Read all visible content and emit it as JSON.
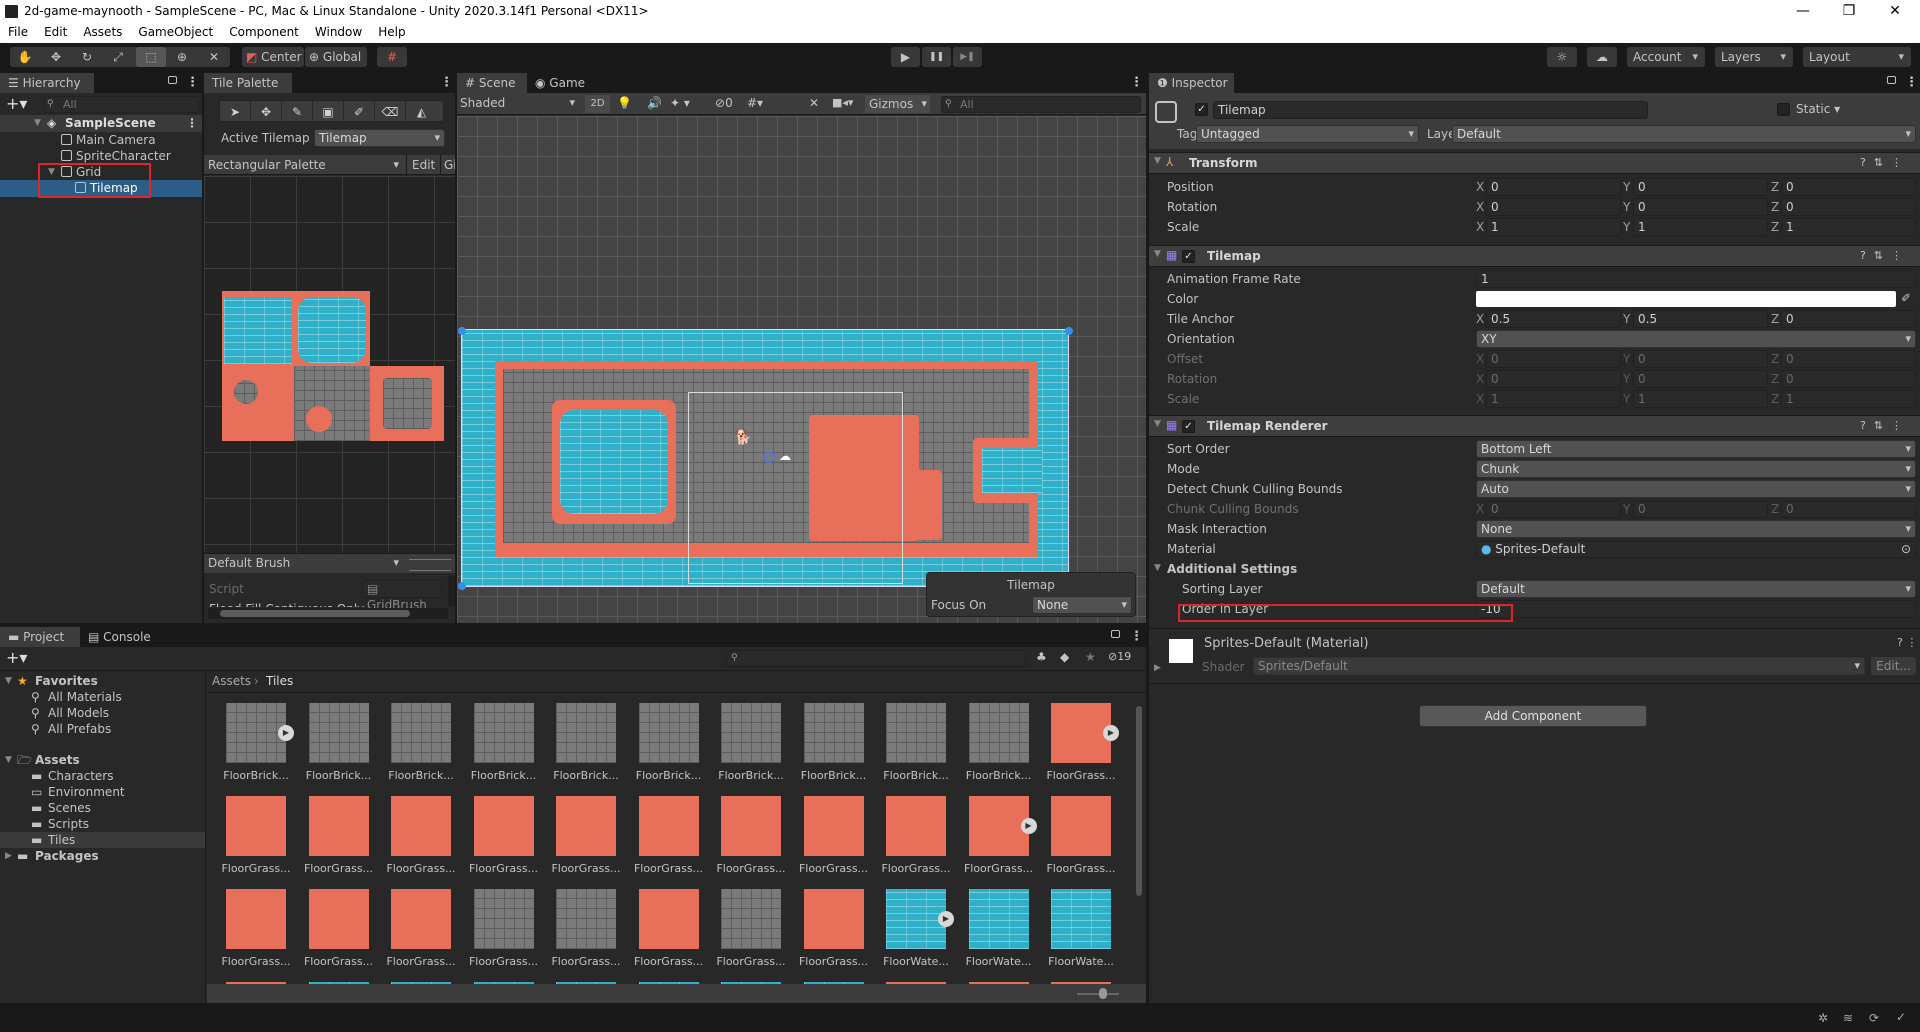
{
  "window": {
    "title": "2d-game-maynooth - SampleScene - PC, Mac & Linux Standalone - Unity 2020.3.14f1 Personal <DX11>",
    "controls": {
      "minimize": "—",
      "maximize": "❐",
      "close": "✕"
    }
  },
  "menu": [
    "File",
    "Edit",
    "Assets",
    "GameObject",
    "Component",
    "Window",
    "Help"
  ],
  "toolbar": {
    "tools": [
      "hand-tool",
      "move-tool",
      "rotate-tool",
      "scale-tool",
      "rect-tool",
      "transform-tool",
      "custom-tool"
    ],
    "active_tool": "rect-tool",
    "pivot_mode": "Center",
    "pivot_rotation": "Global",
    "play": "▶",
    "pause": "❚❚",
    "step": "▶❚",
    "account": "Account",
    "layers": "Layers",
    "layout": "Layout"
  },
  "hierarchy": {
    "tab": "Hierarchy",
    "search_placeholder": "All",
    "items": [
      {
        "label": "SampleScene",
        "depth": 0,
        "type": "scene",
        "expanded": true
      },
      {
        "label": "Main Camera",
        "depth": 1,
        "type": "gameobject"
      },
      {
        "label": "SpriteCharacter",
        "depth": 1,
        "type": "gameobject"
      },
      {
        "label": "Grid",
        "depth": 1,
        "type": "gameobject",
        "expanded": true,
        "highlighted": true
      },
      {
        "label": "Tilemap",
        "depth": 2,
        "type": "gameobject",
        "selected": true,
        "highlighted": true
      }
    ]
  },
  "tile_palette": {
    "tab": "Tile Palette",
    "tools": [
      "select",
      "move",
      "paint",
      "box-fill",
      "picker",
      "erase",
      "flood-fill"
    ],
    "active_tilemap_label": "Active Tilemap",
    "active_tilemap_value": "Tilemap",
    "palette": "Rectangular Palette",
    "edit": "Edit",
    "gizmos": "Gi",
    "brush": "Default Brush",
    "script_label": "Script",
    "script_value": "GridBrush",
    "flood_fill_label": "Flood Fill Contiguous Only"
  },
  "scene": {
    "tabs": [
      "Scene",
      "Game"
    ],
    "active_tab": "Scene",
    "shading": "Shaded",
    "mode_2d": "2D",
    "hidden_count": "0",
    "gizmos": "Gizmos",
    "search_placeholder": "All",
    "overlay_title": "Tilemap",
    "focus_label": "Focus On",
    "focus_value": "None"
  },
  "inspector": {
    "tab": "Inspector",
    "object_name": "Tilemap",
    "active": true,
    "static_label": "Static",
    "tag_label": "Tag",
    "tag_value": "Untagged",
    "layer_label": "Layer",
    "layer_value": "Default",
    "transform": {
      "title": "Transform",
      "rows": [
        {
          "label": "Position",
          "x": "0",
          "y": "0",
          "z": "0"
        },
        {
          "label": "Rotation",
          "x": "0",
          "y": "0",
          "z": "0"
        },
        {
          "label": "Scale",
          "x": "1",
          "y": "1",
          "z": "1"
        }
      ]
    },
    "tilemap": {
      "title": "Tilemap",
      "animation_frame_rate_label": "Animation Frame Rate",
      "animation_frame_rate": "1",
      "color_label": "Color",
      "color_value": "#ffffff",
      "tile_anchor_label": "Tile Anchor",
      "tile_anchor": {
        "x": "0.5",
        "y": "0.5",
        "z": "0"
      },
      "orientation_label": "Orientation",
      "orientation": "XY",
      "dim_rows": [
        {
          "label": "Offset",
          "x": "0",
          "y": "0",
          "z": "0"
        },
        {
          "label": "Rotation",
          "x": "0",
          "y": "0",
          "z": "0"
        },
        {
          "label": "Scale",
          "x": "1",
          "y": "1",
          "z": "1"
        }
      ]
    },
    "renderer": {
      "title": "Tilemap Renderer",
      "sort_order_label": "Sort Order",
      "sort_order": "Bottom Left",
      "mode_label": "Mode",
      "mode": "Chunk",
      "detect_label": "Detect Chunk Culling Bounds",
      "detect": "Auto",
      "chunk_bounds_label": "Chunk Culling Bounds",
      "chunk_bounds": {
        "x": "0",
        "y": "0",
        "z": "0"
      },
      "mask_label": "Mask Interaction",
      "mask": "None",
      "material_label": "Material",
      "material": "Sprites-Default",
      "additional_label": "Additional Settings",
      "sorting_layer_label": "Sorting Layer",
      "sorting_layer": "Default",
      "order_label": "Order in Layer",
      "order": "-10"
    },
    "material": {
      "title": "Sprites-Default (Material)",
      "shader_label": "Shader",
      "shader": "Sprites/Default",
      "edit": "Edit..."
    },
    "add_component": "Add Component"
  },
  "project": {
    "tabs": [
      "Project",
      "Console"
    ],
    "favorites_label": "Favorites",
    "favorites": [
      "All Materials",
      "All Models",
      "All Prefabs"
    ],
    "assets_label": "Assets",
    "folders": [
      "Characters",
      "Environment",
      "Scenes",
      "Scripts",
      "Tiles"
    ],
    "selected_folder": "Tiles",
    "packages_label": "Packages",
    "breadcrumb": [
      "Assets",
      "Tiles"
    ],
    "hidden_count": "19",
    "rows": [
      [
        "FloorBrick...",
        "FloorBrick...",
        "FloorBrick...",
        "FloorBrick...",
        "FloorBrick...",
        "FloorBrick...",
        "FloorBrick...",
        "FloorBrick...",
        "FloorBrick...",
        "FloorBrick...",
        "FloorGrass..."
      ],
      [
        "FloorGrass...",
        "FloorGrass...",
        "FloorGrass...",
        "FloorGrass...",
        "FloorGrass...",
        "FloorGrass...",
        "FloorGrass...",
        "FloorGrass...",
        "FloorGrass...",
        "FloorGrass...",
        "FloorGrass..."
      ],
      [
        "FloorGrass...",
        "FloorGrass...",
        "FloorGrass...",
        "FloorGrass...",
        "FloorGrass...",
        "FloorGrass...",
        "FloorGrass...",
        "FloorGrass...",
        "FloorWate...",
        "FloorWate...",
        "FloorWate..."
      ]
    ]
  },
  "colors": {
    "accent_selected": "#2c5d87",
    "highlight_box": "#e0242c",
    "grass": "#e8705a",
    "water": "#2db0c8"
  }
}
